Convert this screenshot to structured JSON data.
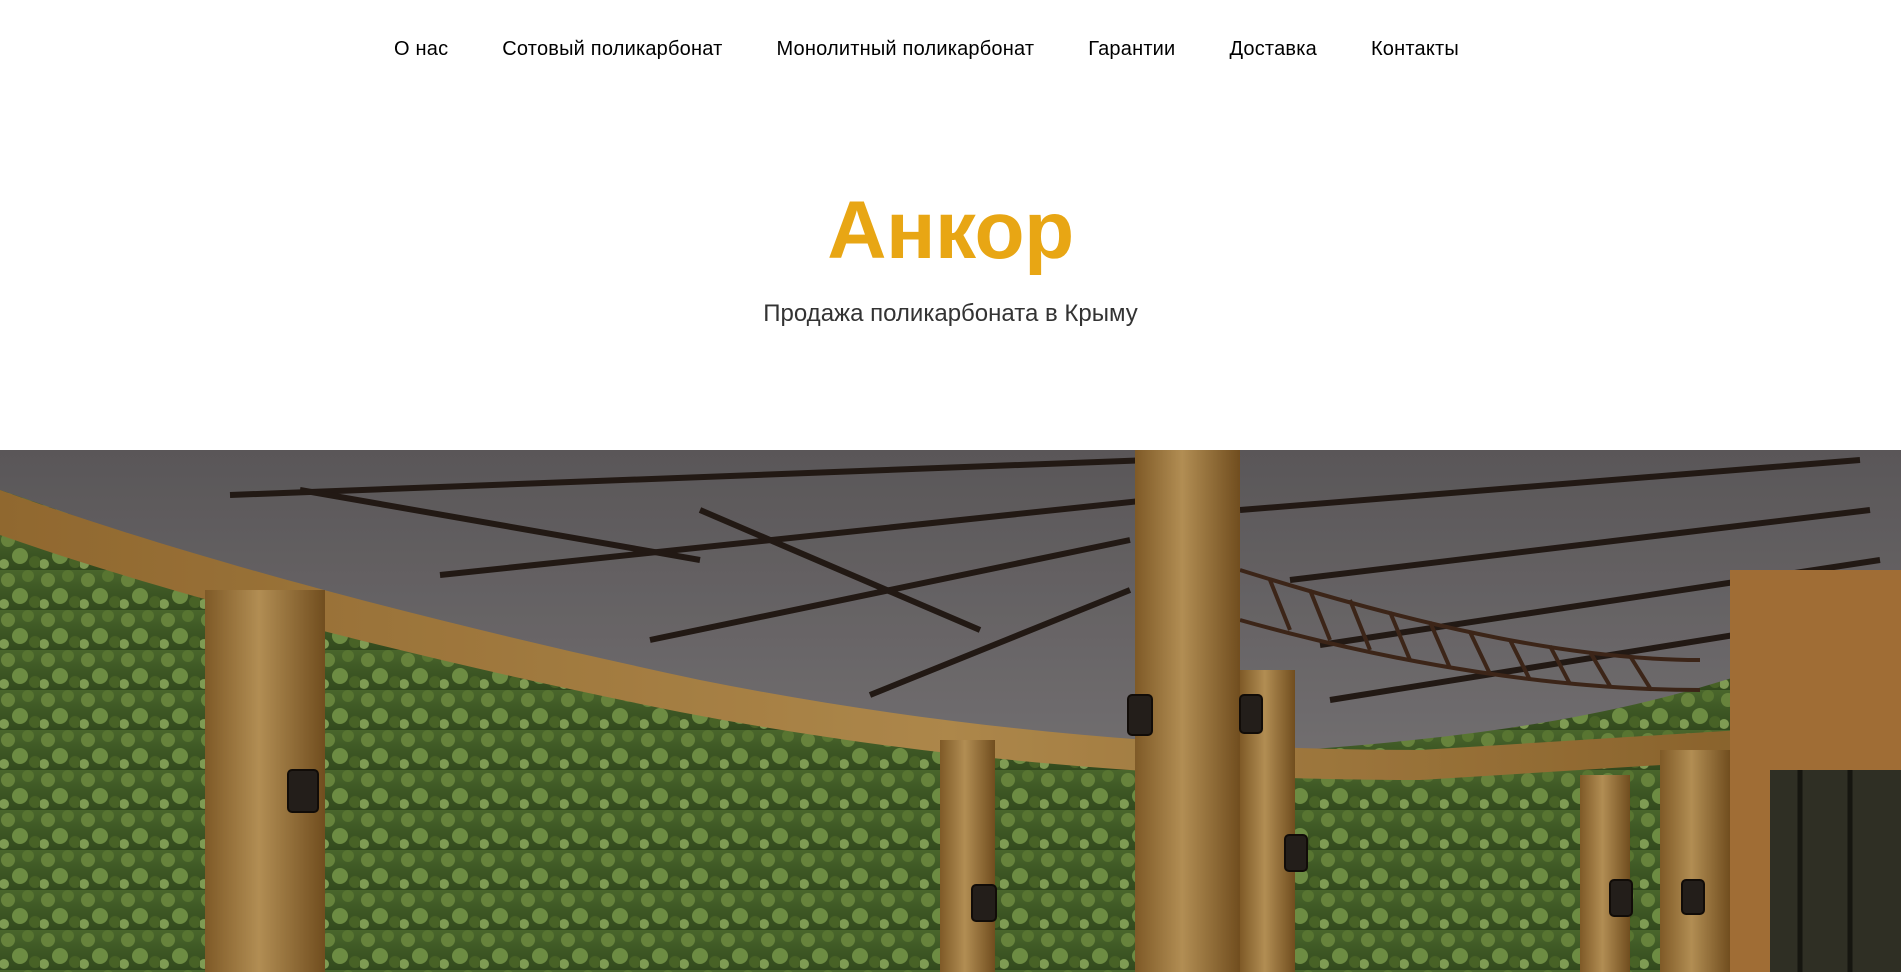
{
  "nav": {
    "items": [
      {
        "label": "О нас"
      },
      {
        "label": "Сотовый поликарбонат"
      },
      {
        "label": "Монолитный поликарбонат"
      },
      {
        "label": "Гарантии"
      },
      {
        "label": "Доставка"
      },
      {
        "label": "Контакты"
      }
    ]
  },
  "hero": {
    "title": "Анкор",
    "subtitle": "Продажа поликарбоната в Крыму"
  },
  "colors": {
    "accent": "#e8a614",
    "text": "#000000",
    "subtitle": "#333333"
  },
  "banner": {
    "image_icon": "polycarbonate-canopy-photo"
  }
}
